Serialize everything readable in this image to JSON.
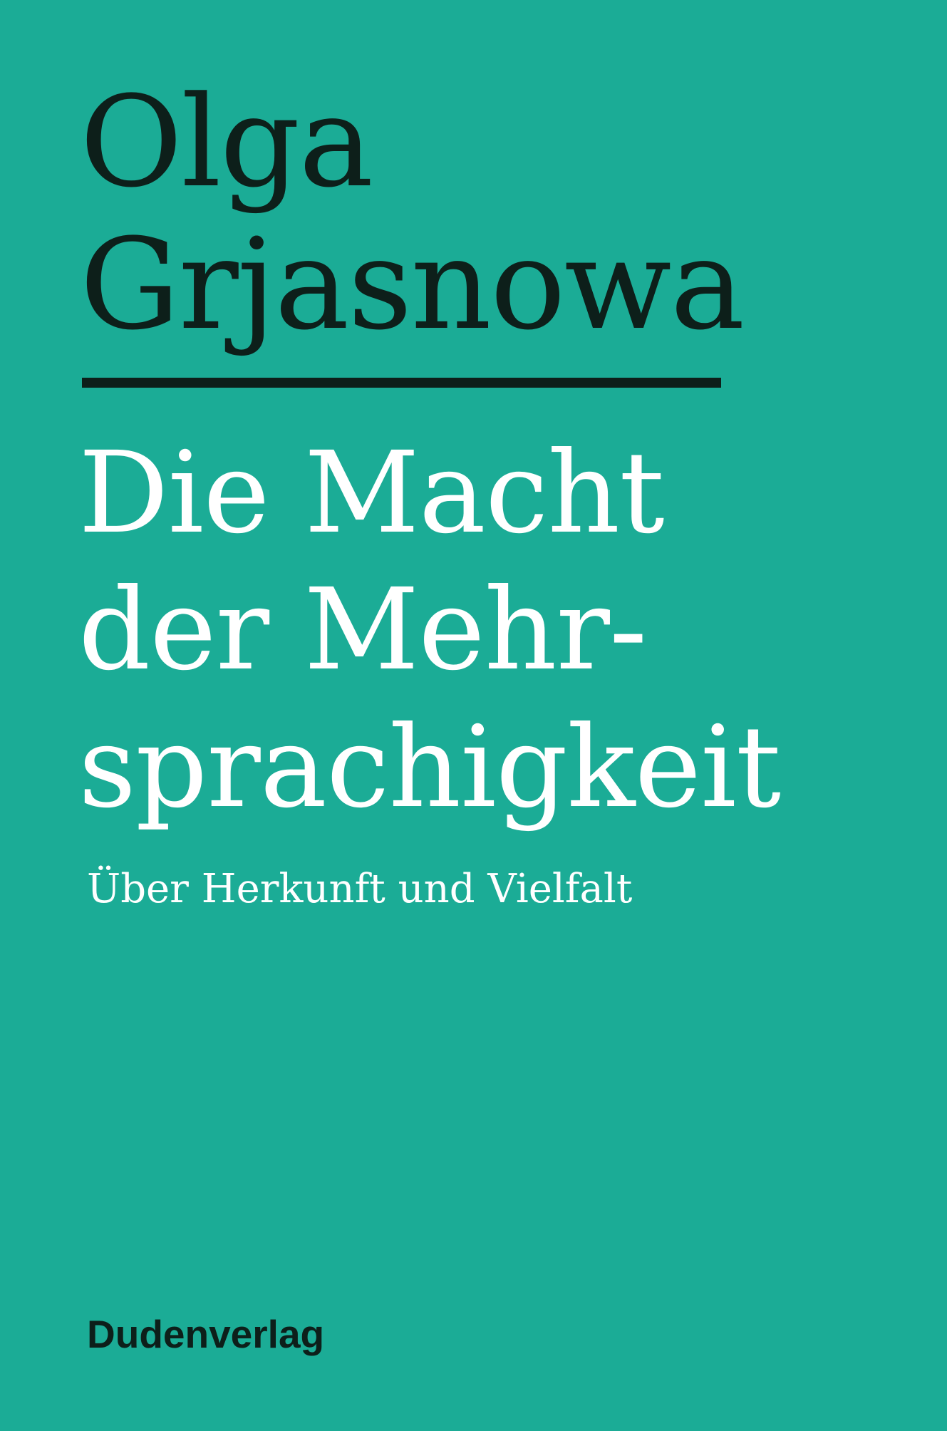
{
  "cover": {
    "background_color": "#1bac96",
    "text_dark_color": "#0d1f1a",
    "text_light_color": "#ffffff",
    "author_lines": [
      "Olga",
      "Grjasnowa"
    ],
    "title_lines": [
      "Die Macht",
      "der Mehr-",
      "sprachigkeit"
    ],
    "subtitle": "Über Herkunft und Vielfalt",
    "publisher": "Dudenverlag"
  }
}
